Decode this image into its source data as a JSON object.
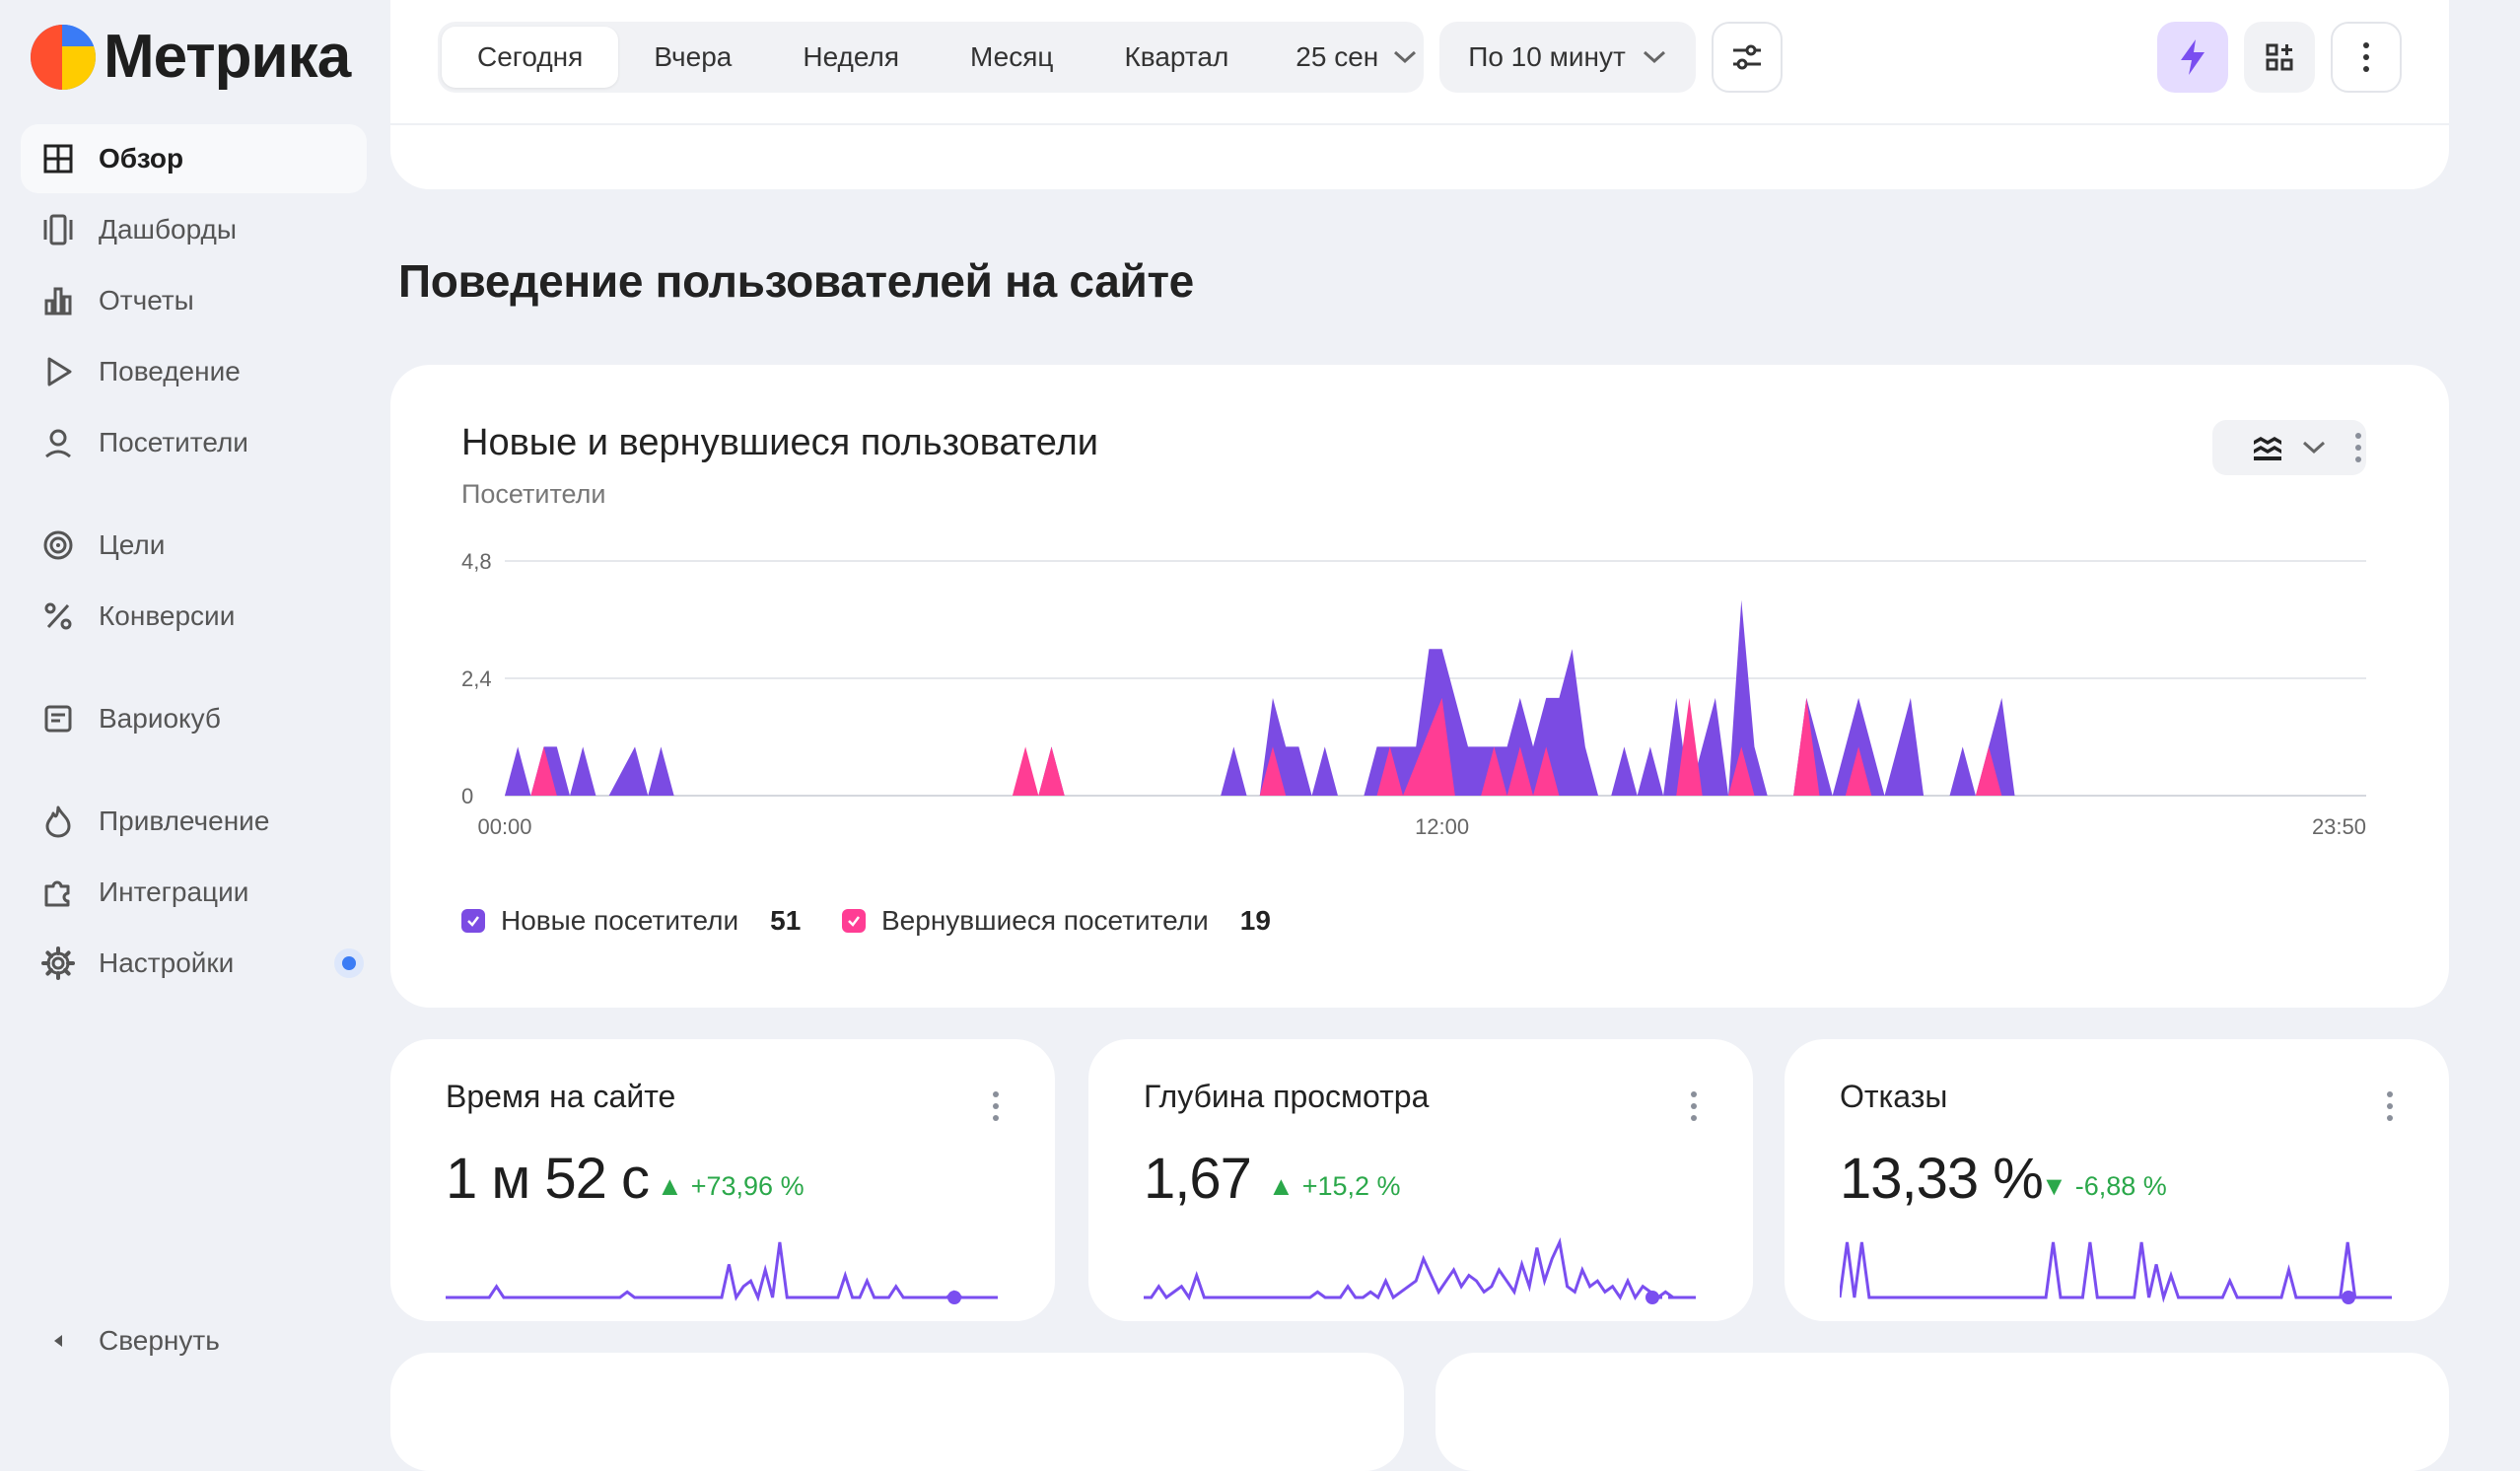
{
  "app": {
    "logo_text": "Метрика"
  },
  "sidebar": {
    "items": [
      {
        "label": "Обзор",
        "icon": "grid-icon"
      },
      {
        "label": "Дашборды",
        "icon": "dashboards-icon"
      },
      {
        "label": "Отчеты",
        "icon": "bar-chart-icon"
      },
      {
        "label": "Поведение",
        "icon": "play-icon"
      },
      {
        "label": "Посетители",
        "icon": "user-icon"
      },
      {
        "label": "Цели",
        "icon": "target-icon"
      },
      {
        "label": "Конверсии",
        "icon": "percent-icon"
      },
      {
        "label": "Вариокуб",
        "icon": "cube-table-icon"
      },
      {
        "label": "Привлечение",
        "icon": "flame-icon"
      },
      {
        "label": "Интеграции",
        "icon": "puzzle-icon"
      },
      {
        "label": "Настройки",
        "icon": "gear-icon"
      }
    ],
    "collapse_label": "Свернуть"
  },
  "toolbar": {
    "periods": [
      "Сегодня",
      "Вчера",
      "Неделя",
      "Месяц",
      "Квартал"
    ],
    "date_label": "25 сен",
    "grouping_label": "По 10 минут"
  },
  "colors": {
    "new": "#7b4be3",
    "returning": "#ff3d94",
    "accent": "#7a4ef0",
    "positive": "#2ba84a"
  },
  "section": {
    "title": "Поведение пользователей на сайте"
  },
  "chart_card": {
    "title": "Новые и вернувшиеся пользователи",
    "subtitle": "Посетители",
    "legend": [
      {
        "name": "Новые посетители",
        "total": "51"
      },
      {
        "name": "Вернувшиеся посетители",
        "total": "19"
      }
    ]
  },
  "chart_data": {
    "type": "area",
    "stacked": true,
    "x_tick_labels": [
      "00:00",
      "12:00",
      "23:50"
    ],
    "y_tick_labels": [
      "4,8",
      "2,4",
      "0"
    ],
    "ylim": [
      0,
      4.8
    ],
    "xlim_minutes": [
      0,
      1430
    ],
    "grid": true,
    "legend_placement": "bottom-left",
    "series": [
      {
        "name": "Новые посетители",
        "points": [
          [
            0,
            0
          ],
          [
            10,
            1
          ],
          [
            20,
            0
          ],
          [
            30,
            1
          ],
          [
            40,
            1
          ],
          [
            50,
            0
          ],
          [
            60,
            1
          ],
          [
            70,
            0
          ],
          [
            80,
            0
          ],
          [
            100,
            1
          ],
          [
            110,
            0
          ],
          [
            120,
            1
          ],
          [
            130,
            0
          ],
          [
            410,
            0
          ],
          [
            420,
            1
          ],
          [
            430,
            0
          ],
          [
            550,
            0
          ],
          [
            560,
            1
          ],
          [
            570,
            0
          ],
          [
            580,
            0
          ],
          [
            590,
            2
          ],
          [
            600,
            1
          ],
          [
            610,
            1
          ],
          [
            620,
            0
          ],
          [
            630,
            1
          ],
          [
            640,
            0
          ],
          [
            660,
            0
          ],
          [
            670,
            1
          ],
          [
            680,
            1
          ],
          [
            690,
            1
          ],
          [
            700,
            1
          ],
          [
            710,
            3
          ],
          [
            720,
            3
          ],
          [
            730,
            2
          ],
          [
            740,
            1
          ],
          [
            750,
            1
          ],
          [
            760,
            1
          ],
          [
            770,
            1
          ],
          [
            780,
            2
          ],
          [
            790,
            1
          ],
          [
            800,
            2
          ],
          [
            810,
            2
          ],
          [
            820,
            3
          ],
          [
            830,
            1
          ],
          [
            840,
            0
          ],
          [
            850,
            0
          ],
          [
            860,
            1
          ],
          [
            870,
            0
          ],
          [
            880,
            1
          ],
          [
            890,
            0
          ],
          [
            900,
            2
          ],
          [
            910,
            0
          ],
          [
            920,
            1
          ],
          [
            930,
            2
          ],
          [
            940,
            0
          ],
          [
            950,
            4
          ],
          [
            960,
            1
          ],
          [
            970,
            0
          ],
          [
            990,
            0
          ],
          [
            1000,
            2
          ],
          [
            1010,
            1
          ],
          [
            1020,
            0
          ],
          [
            1030,
            1
          ],
          [
            1040,
            2
          ],
          [
            1050,
            1
          ],
          [
            1060,
            0
          ],
          [
            1070,
            1
          ],
          [
            1080,
            2
          ],
          [
            1090,
            0
          ],
          [
            1110,
            0
          ],
          [
            1120,
            1
          ],
          [
            1130,
            0
          ],
          [
            1140,
            1
          ],
          [
            1150,
            2
          ],
          [
            1160,
            0
          ]
        ]
      },
      {
        "name": "Вернувшиеся посетители",
        "points": [
          [
            20,
            0
          ],
          [
            30,
            1
          ],
          [
            40,
            0
          ],
          [
            390,
            0
          ],
          [
            400,
            1
          ],
          [
            410,
            0
          ],
          [
            420,
            1
          ],
          [
            430,
            0
          ],
          [
            580,
            0
          ],
          [
            590,
            1
          ],
          [
            600,
            0
          ],
          [
            670,
            0
          ],
          [
            680,
            1
          ],
          [
            690,
            0
          ],
          [
            720,
            2
          ],
          [
            730,
            0
          ],
          [
            750,
            0
          ],
          [
            760,
            1
          ],
          [
            770,
            0
          ],
          [
            780,
            1
          ],
          [
            790,
            0
          ],
          [
            800,
            1
          ],
          [
            810,
            0
          ],
          [
            900,
            0
          ],
          [
            910,
            2
          ],
          [
            920,
            0
          ],
          [
            940,
            0
          ],
          [
            950,
            1
          ],
          [
            960,
            0
          ],
          [
            990,
            0
          ],
          [
            1000,
            2
          ],
          [
            1010,
            0
          ],
          [
            1030,
            0
          ],
          [
            1040,
            1
          ],
          [
            1050,
            0
          ],
          [
            1130,
            0
          ],
          [
            1140,
            1
          ],
          [
            1150,
            0
          ]
        ]
      }
    ]
  },
  "metrics": [
    {
      "title": "Время на сайте",
      "value": "1 м 52 с",
      "delta": "+73,96 %",
      "direction": "up",
      "spark": [
        0,
        0,
        0,
        0,
        0,
        0,
        0,
        0.2,
        0,
        0,
        0,
        0,
        0,
        0,
        0,
        0,
        0,
        0,
        0,
        0,
        0,
        0,
        0,
        0,
        0,
        0.1,
        0,
        0,
        0,
        0,
        0,
        0,
        0,
        0,
        0,
        0,
        0,
        0,
        0,
        0.6,
        0,
        0.2,
        0.3,
        0,
        0.5,
        0,
        1,
        0,
        0,
        0,
        0,
        0,
        0,
        0,
        0,
        0.4,
        0,
        0,
        0.3,
        0,
        0,
        0,
        0.2,
        0,
        0,
        0,
        0,
        0,
        0,
        0,
        0.1,
        0,
        0,
        0,
        0,
        0,
        0
      ]
    },
    {
      "title": "Глубина просмотра",
      "value": "1,67",
      "delta": "+15,2 %",
      "direction": "up",
      "spark": [
        0,
        0,
        0.2,
        0,
        0.1,
        0.2,
        0,
        0.4,
        0,
        0,
        0,
        0,
        0,
        0,
        0,
        0,
        0,
        0,
        0,
        0,
        0,
        0,
        0,
        0.1,
        0,
        0,
        0,
        0.2,
        0,
        0,
        0.1,
        0,
        0.3,
        0,
        0.1,
        0.2,
        0.3,
        0.7,
        0.4,
        0.1,
        0.3,
        0.5,
        0.2,
        0.4,
        0.3,
        0.1,
        0.2,
        0.5,
        0.3,
        0.1,
        0.6,
        0.2,
        0.9,
        0.3,
        0.7,
        1,
        0.2,
        0.1,
        0.5,
        0.2,
        0.3,
        0.1,
        0.2,
        0,
        0.3,
        0,
        0.2,
        0.1,
        0,
        0.1,
        0,
        0,
        0,
        0
      ]
    },
    {
      "title": "Отказы",
      "value": "13,33 %",
      "delta": "-6,88 %",
      "direction": "down",
      "spark": [
        0,
        1,
        0,
        1,
        0,
        0,
        0,
        0,
        0,
        0,
        0,
        0,
        0,
        0,
        0,
        0,
        0,
        0,
        0,
        0,
        0,
        0,
        0,
        0,
        0,
        0,
        0,
        0,
        0,
        1,
        0,
        0,
        0,
        0,
        1,
        0,
        0,
        0,
        0,
        0,
        0,
        1,
        0,
        0.6,
        0,
        0.4,
        0,
        0,
        0,
        0,
        0,
        0,
        0,
        0.3,
        0,
        0,
        0,
        0,
        0,
        0,
        0,
        0.5,
        0,
        0,
        0,
        0,
        0,
        0,
        0,
        1,
        0,
        0,
        0,
        0,
        0,
        0
      ]
    }
  ]
}
